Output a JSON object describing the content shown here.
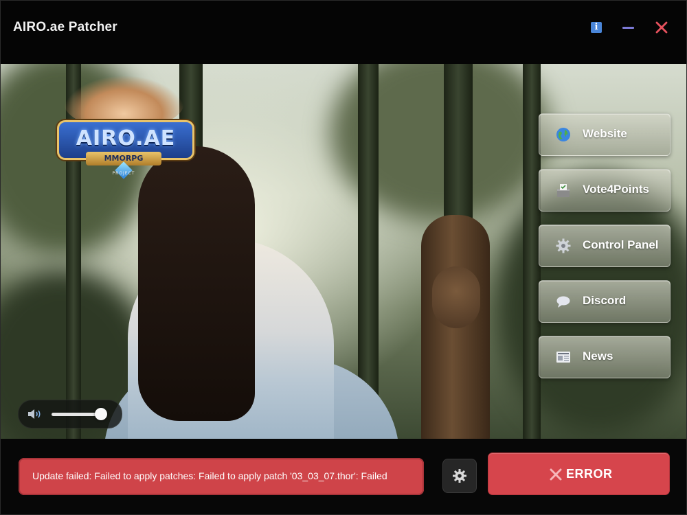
{
  "app": {
    "title": "AIRO.ae Patcher"
  },
  "titlebar": {
    "info_icon": "info-icon",
    "minimize_icon": "minimize-icon",
    "close_icon": "close-icon"
  },
  "logo": {
    "title": "AIRO.AE",
    "subtitle": "MMORPG",
    "caption": "PROJECT"
  },
  "menu": [
    {
      "label": "Website",
      "icon": "globe-icon"
    },
    {
      "label": "Vote4Points",
      "icon": "ballot-box-icon"
    },
    {
      "label": "Control Panel",
      "icon": "gear-icon"
    },
    {
      "label": "Discord",
      "icon": "speech-bubble-icon"
    },
    {
      "label": "News",
      "icon": "newspaper-icon"
    }
  ],
  "volume": {
    "icon": "speaker-icon",
    "level": 0.9
  },
  "status": {
    "text": "Update failed: Failed to apply patches: Failed to apply patch '03_03_07.thor': Failed",
    "color": "#cf4449"
  },
  "settings_button": {
    "icon": "gear-icon"
  },
  "action_button": {
    "label": "ERROR",
    "icon": "x-icon",
    "color": "#d6454c"
  },
  "colors": {
    "accent_blue": "#4a86d9",
    "minimize": "#7c7ad6",
    "close": "#e8525e"
  }
}
